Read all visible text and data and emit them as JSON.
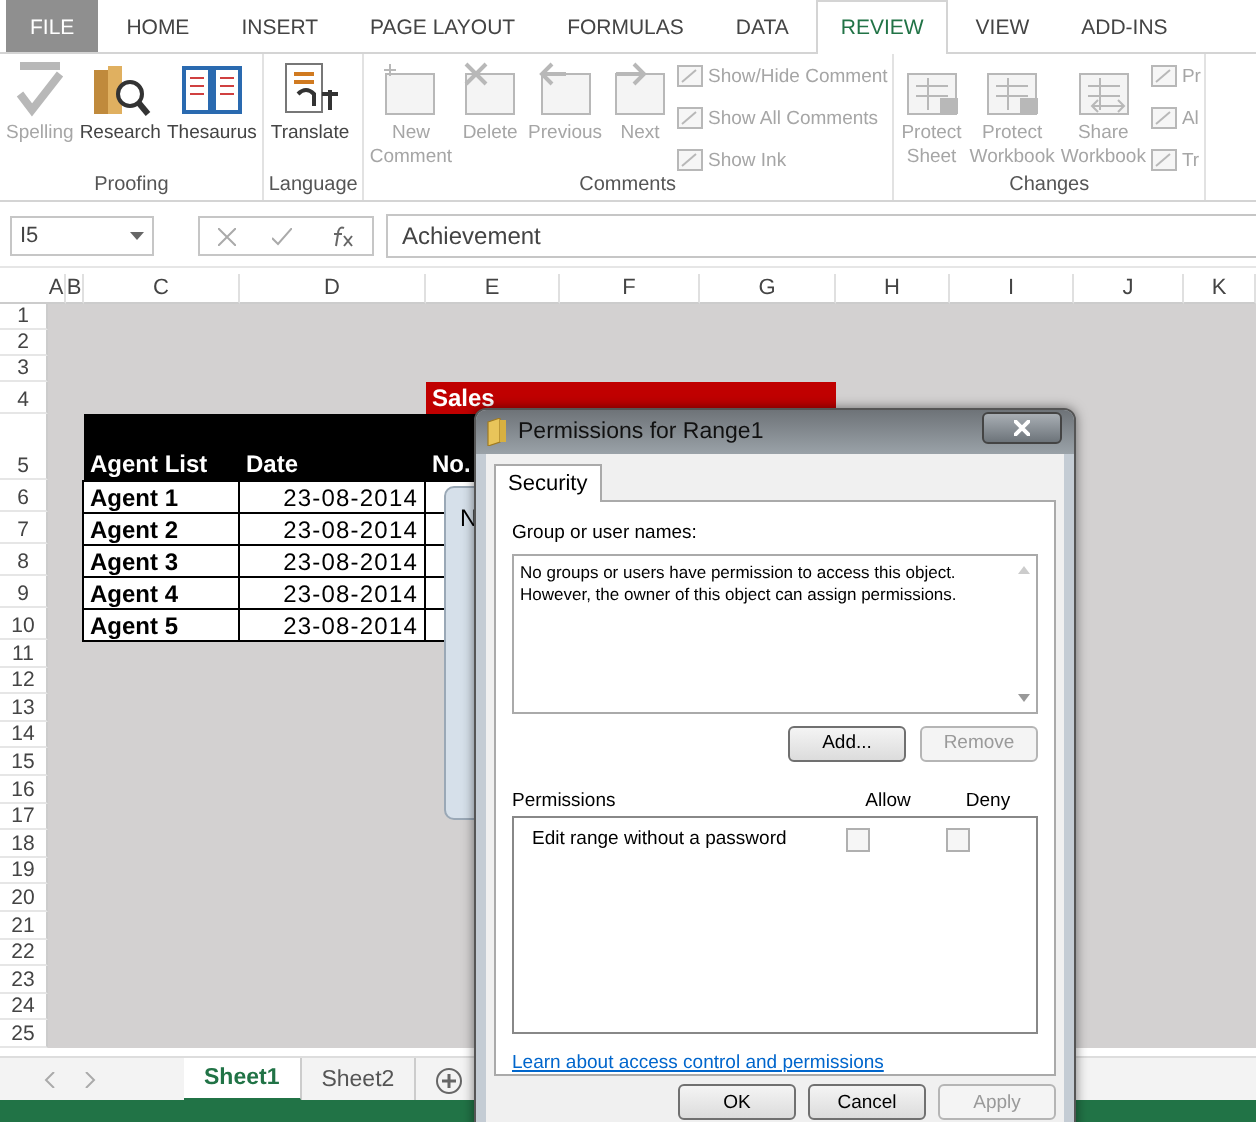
{
  "ribbon_tabs": [
    {
      "label": "FILE",
      "selected": false,
      "kind": "file"
    },
    {
      "label": "HOME",
      "selected": false
    },
    {
      "label": "INSERT",
      "selected": false
    },
    {
      "label": "PAGE LAYOUT",
      "selected": false
    },
    {
      "label": "FORMULAS",
      "selected": false
    },
    {
      "label": "DATA",
      "selected": false
    },
    {
      "label": "REVIEW",
      "selected": true
    },
    {
      "label": "VIEW",
      "selected": false
    },
    {
      "label": "ADD-INS",
      "selected": false
    }
  ],
  "ribbon_groups": [
    {
      "label": "Proofing",
      "items": [
        {
          "label": "Spelling",
          "kind": "large",
          "disabled": true
        },
        {
          "label": "Research",
          "kind": "large",
          "disabled": false
        },
        {
          "label": "Thesaurus",
          "kind": "large",
          "disabled": false
        }
      ]
    },
    {
      "label": "Language",
      "items": [
        {
          "label": "Translate",
          "kind": "large",
          "disabled": false
        }
      ]
    },
    {
      "label": "Comments",
      "items": [
        {
          "label": "New Comment",
          "kind": "large",
          "disabled": true
        },
        {
          "label": "Delete",
          "kind": "large",
          "disabled": true
        },
        {
          "label": "Previous",
          "kind": "large",
          "disabled": true
        },
        {
          "label": "Next",
          "kind": "large",
          "disabled": true
        },
        {
          "label": "Show/Hide Comment",
          "kind": "small",
          "disabled": true
        },
        {
          "label": "Show All Comments",
          "kind": "small",
          "disabled": true
        },
        {
          "label": "Show Ink",
          "kind": "small",
          "disabled": true
        }
      ]
    },
    {
      "label": "Changes",
      "items": [
        {
          "label": "Protect Sheet",
          "kind": "large",
          "disabled": true
        },
        {
          "label": "Protect Workbook",
          "kind": "large",
          "disabled": true
        },
        {
          "label": "Share Workbook",
          "kind": "large",
          "disabled": true
        },
        {
          "label": "Pr",
          "kind": "small",
          "disabled": true
        },
        {
          "label": "Al",
          "kind": "small",
          "disabled": true
        },
        {
          "label": "Tr",
          "kind": "small",
          "disabled": true
        }
      ]
    }
  ],
  "name_box": "I5",
  "formula": "Achievement",
  "columns": [
    "A",
    "B",
    "C",
    "D",
    "E",
    "F",
    "G",
    "H",
    "I",
    "J",
    "K"
  ],
  "rows": [
    "1",
    "2",
    "3",
    "4",
    "5",
    "6",
    "7",
    "8",
    "9",
    "10",
    "11",
    "12",
    "13",
    "14",
    "15",
    "16",
    "17",
    "18",
    "19",
    "20",
    "21",
    "22",
    "23",
    "24",
    "25"
  ],
  "sales_header": "Sales",
  "table": {
    "columns": [
      "Agent List",
      "Date",
      "No."
    ],
    "rows": [
      [
        "Agent 1",
        "23-08-2014"
      ],
      [
        "Agent 2",
        "23-08-2014"
      ],
      [
        "Agent 3",
        "23-08-2014"
      ],
      [
        "Agent 4",
        "23-08-2014"
      ],
      [
        "Agent 5",
        "23-08-2014"
      ]
    ]
  },
  "sheet_tabs": [
    {
      "label": "Sheet1",
      "selected": true
    },
    {
      "label": "Sheet2",
      "selected": false
    }
  ],
  "back_dialog": {
    "title": "N"
  },
  "dialog": {
    "title": "Permissions for Range1",
    "tabs": [
      {
        "label": "Security",
        "selected": true
      }
    ],
    "group_label": "Group or user names:",
    "group_message": [
      "No groups or users have permission to access this object.",
      "However, the owner of this object can assign permissions."
    ],
    "group_buttons": [
      {
        "label": "Add...",
        "disabled": false
      },
      {
        "label": "Remove",
        "disabled": true
      }
    ],
    "permissions_label": "Permissions",
    "permission_columns": [
      "Allow",
      "Deny"
    ],
    "permissions": [
      {
        "name": "Edit range without a password",
        "allow": false,
        "deny": false
      }
    ],
    "link": "Learn about access control and permissions",
    "buttons": [
      {
        "label": "OK",
        "disabled": false
      },
      {
        "label": "Cancel",
        "disabled": false
      },
      {
        "label": "Apply",
        "disabled": true
      }
    ]
  }
}
